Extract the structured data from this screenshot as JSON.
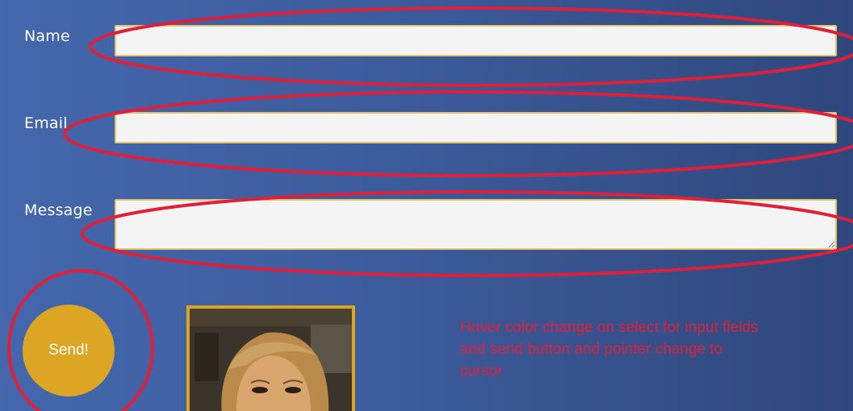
{
  "form": {
    "name_label": "Name",
    "name_value": "",
    "email_label": "Email",
    "email_value": "",
    "message_label": "Message",
    "message_value": "",
    "send_label": "Send!"
  },
  "annotation": {
    "note": "Hover color change on select for input fields and send button and pointer change to cursor",
    "color": "#e0203a"
  },
  "colors": {
    "background_left": "#4467ad",
    "background_right": "#2f477d",
    "field_border": "#e5c46a",
    "accent": "#dca624"
  }
}
